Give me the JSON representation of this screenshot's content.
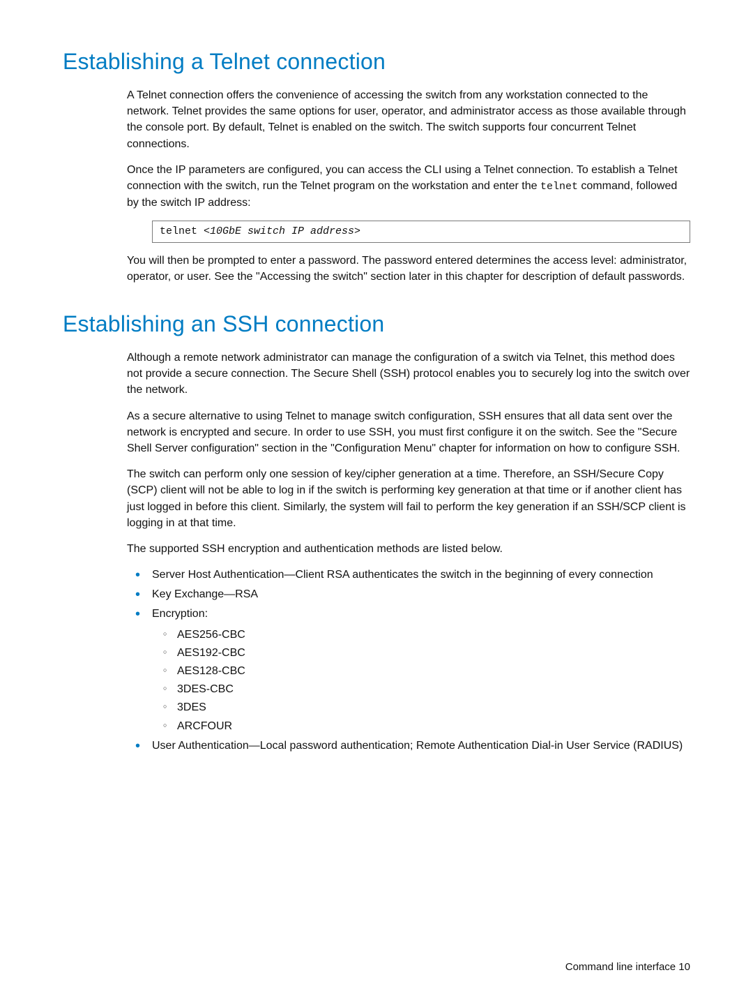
{
  "section_telnet": {
    "title": "Establishing a Telnet connection",
    "p1": "A Telnet connection offers the convenience of accessing the switch from any workstation connected to the network. Telnet provides the same options for user, operator, and administrator access as those available through the console port. By default, Telnet is enabled on the switch. The switch supports four concurrent Telnet connections.",
    "p2_pre": "Once the IP parameters are configured, you can access the CLI using a Telnet connection. To establish a Telnet connection with the switch, run the Telnet program on the workstation and enter the ",
    "p2_code": "telnet",
    "p2_post": " command, followed by the switch IP address:",
    "cmd_prefix": "telnet ",
    "cmd_arg": "<10GbE switch IP address>",
    "p3": "You will then be prompted to enter a password. The password entered determines the access level: administrator, operator, or user. See the \"Accessing the switch\" section later in this chapter for description of default passwords."
  },
  "section_ssh": {
    "title": "Establishing an SSH connection",
    "p1": "Although a remote network administrator can manage the configuration of a switch via Telnet, this method does not provide a secure connection. The Secure Shell (SSH) protocol enables you to securely log into the switch over the network.",
    "p2": "As a secure alternative to using Telnet to manage switch configuration, SSH ensures that all data sent over the network is encrypted and secure. In order to use SSH, you must first configure it on the switch. See the \"Secure Shell Server configuration\" section in the \"Configuration Menu\" chapter for information on how to configure SSH.",
    "p3": "The switch can perform only one session of key/cipher generation at a time. Therefore, an SSH/Secure Copy (SCP) client will not be able to log in if the switch is performing key generation at that time or if another client has just logged in before this client. Similarly, the system will fail to perform the key generation if an SSH/SCP client is logging in at that time.",
    "p4": "The supported SSH encryption and authentication methods are listed below.",
    "bullets": {
      "b1": "Server Host Authentication—Client RSA authenticates the switch in the beginning of every connection",
      "b2": "Key Exchange—RSA",
      "b3": "Encryption:",
      "b3_sub": {
        "s1": "AES256-CBC",
        "s2": "AES192-CBC",
        "s3": "AES128-CBC",
        "s4": "3DES-CBC",
        "s5": "3DES",
        "s6": "ARCFOUR"
      },
      "b4": "User Authentication—Local password authentication; Remote Authentication Dial-in User Service (RADIUS)"
    }
  },
  "footer": "Command line interface  10"
}
